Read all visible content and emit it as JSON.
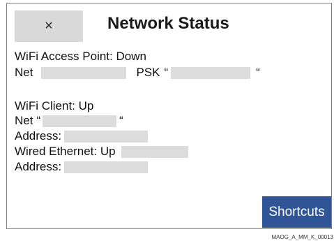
{
  "dialog": {
    "close_label": "×",
    "title": "Network Status"
  },
  "wifi_ap": {
    "status_line": "WiFi Access Point: Down",
    "net_label": "Net",
    "psk_label": "PSK",
    "open_quote": "“",
    "close_quote": "“"
  },
  "wifi_client": {
    "status_line": "WiFi Client: Up",
    "net_label": "Net",
    "open_quote": "“",
    "close_quote": "“",
    "address_label": "Address:"
  },
  "wired": {
    "status_line": "Wired Ethernet: Up",
    "address_label": "Address:"
  },
  "footer": {
    "shortcuts_label": "Shortcuts",
    "figure_id": "MAOG_A_MM_K_00013"
  },
  "colors": {
    "close_button_bg": "#d9d9d9",
    "shortcuts_bg": "#2f5597",
    "redaction": "#dcdcdc"
  }
}
